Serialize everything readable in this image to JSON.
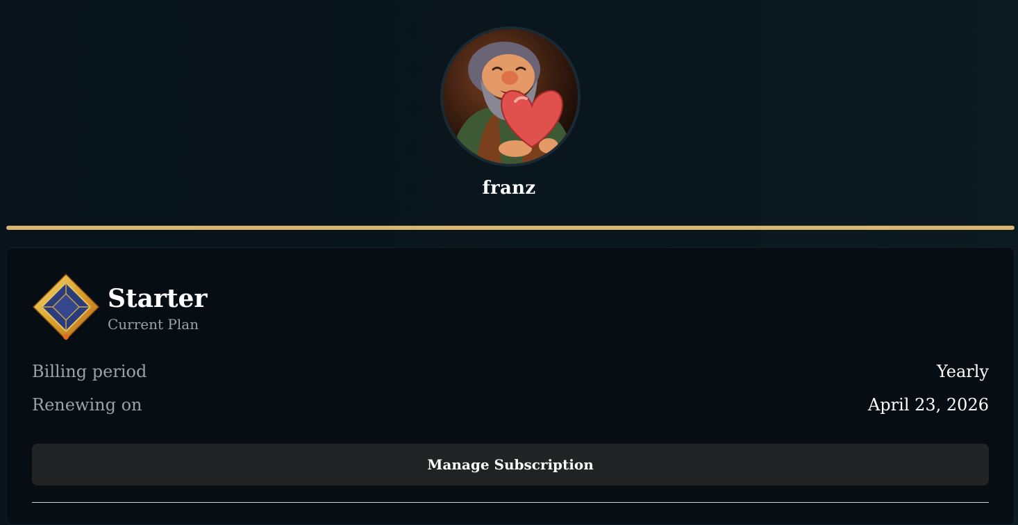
{
  "profile": {
    "username": "franz",
    "avatar_icon": "smiling-dwarf-holding-heart-avatar"
  },
  "plan": {
    "badge_icon": "gold-diamond-gem-badge-icon",
    "name": "Starter",
    "subtitle": "Current Plan",
    "billing_label": "Billing period",
    "billing_value": "Yearly",
    "renew_label": "Renewing on",
    "renew_value": "April 23, 2026",
    "manage_label": "Manage Subscription"
  },
  "colors": {
    "accent_gold": "#d9b572",
    "background": "#08131b",
    "card": "#060e14",
    "button": "#222324",
    "muted_text": "#9aa3ab"
  }
}
